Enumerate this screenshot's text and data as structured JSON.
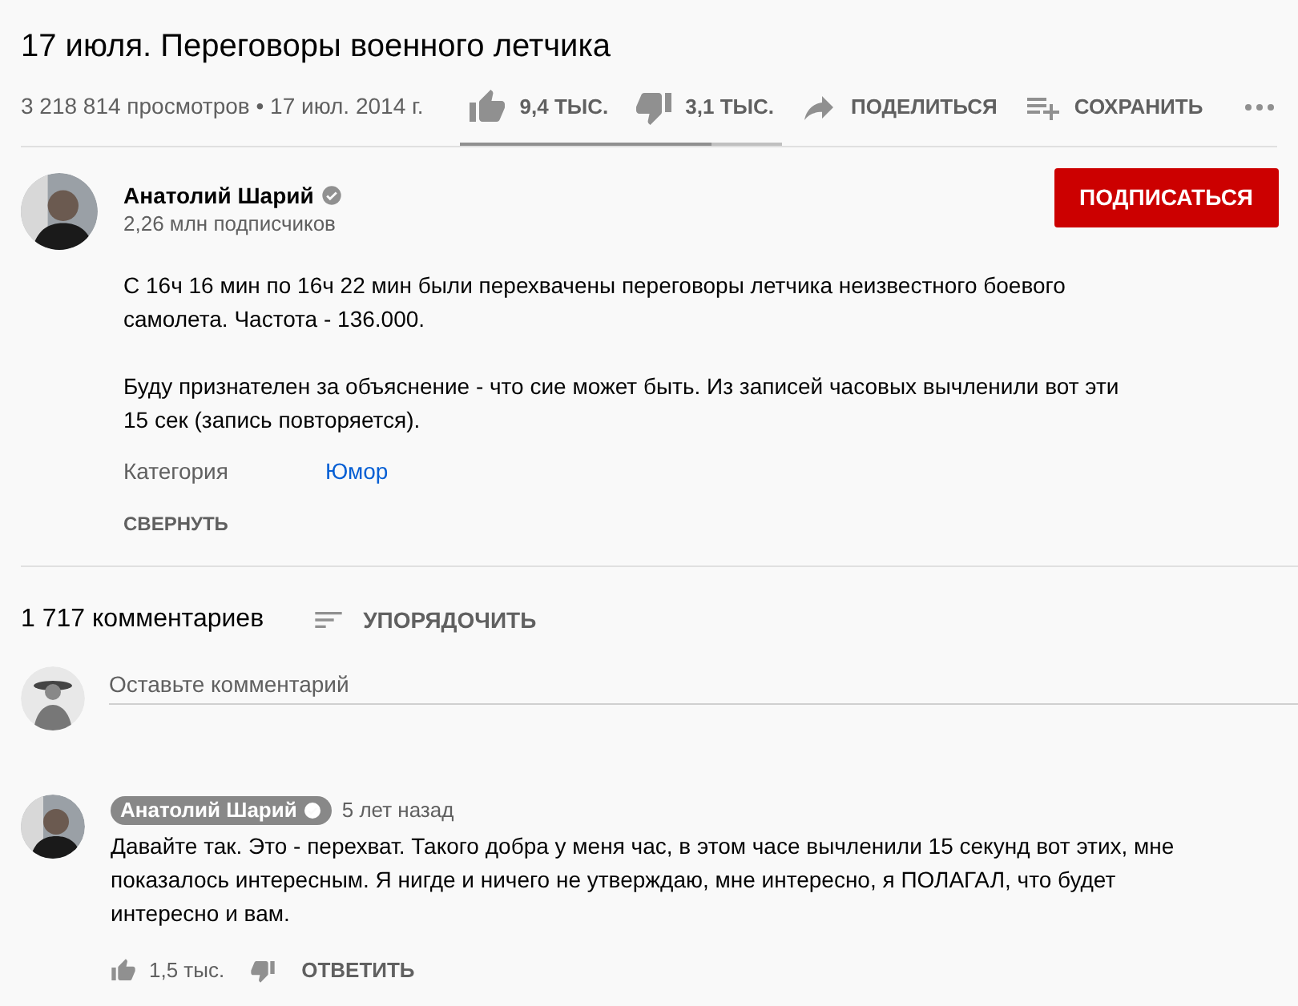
{
  "video": {
    "title": "17 июля. Переговоры военного летчика",
    "views": "3 218 814 просмотров • 17 июл. 2014 г."
  },
  "actions": [
    {
      "kind": "like",
      "label": "9,4 ТЫС."
    },
    {
      "kind": "dislike",
      "label": "3,1 ТЫС."
    },
    {
      "kind": "share",
      "label": "ПОДЕЛИТЬСЯ"
    },
    {
      "kind": "save",
      "label": "СОХРАНИТЬ"
    },
    {
      "kind": "more"
    }
  ],
  "sentiment": {
    "level": 0.78
  },
  "channel": {
    "name": "Анатолий Шарий",
    "verified": true,
    "subscribers": "2,26 млн подписчиков",
    "subscribe": "ПОДПИСАТЬСЯ"
  },
  "description": {
    "paragraphs": [
      "С 16ч 16 мин по 16ч 22 мин были перехвачены переговоры летчика неизвестного боевого самолета. Частота - 136.000.",
      "Буду признателен за объяснение - что сие может быть. Из записей часовых вычленили вот эти 15 сек (запись повторяется)."
    ],
    "category_label": "Категория",
    "category": "Юмор",
    "collapse": "СВЕРНУТЬ"
  },
  "comments_header": {
    "count": "1 717 комментариев",
    "sort": "УПОРЯДОЧИТЬ"
  },
  "comment_box": {
    "placeholder": "Оставьте комментарий"
  },
  "comments": [
    {
      "author": "Анатолий Шарий",
      "author_is_owner": true,
      "verified": true,
      "time": "5 лет назад",
      "text": "Давайте так. Это - перехват. Такого добра у меня час, в этом часе вычленили 15 секунд вот этих, мне показалось интересным. Я нигде и ничего не утверждаю, мне интересно, я ПОЛАГАЛ, что будет интересно и вам.",
      "likes": "1,5 тыс.",
      "reply": "ОТВЕТИТЬ"
    }
  ]
}
